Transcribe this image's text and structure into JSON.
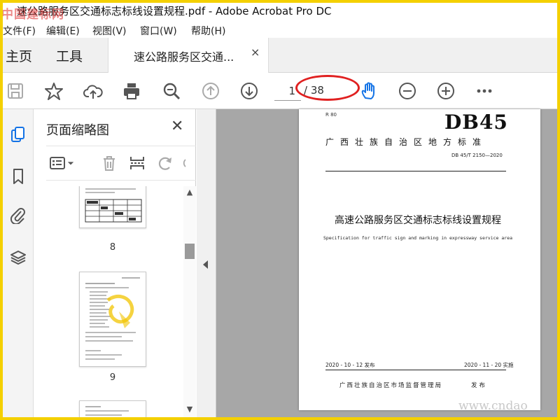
{
  "window": {
    "title": "速公路服务区交通标志标线设置规程.pdf - Adobe Acrobat Pro DC",
    "watermark_top": "中国建标网",
    "watermark_bottom": "www.cndao"
  },
  "menu": [
    "文件(F)",
    "编辑(E)",
    "视图(V)",
    "窗口(W)",
    "帮助(H)"
  ],
  "tabs": {
    "home": "主页",
    "tools": "工具",
    "document": "速公路服务区交通...",
    "close": "×"
  },
  "toolbar": {
    "icons": [
      "save-icon",
      "bookmark-star-icon",
      "upload-cloud-icon",
      "print-icon",
      "zoom-search-icon",
      "page-up-icon",
      "page-down-icon",
      "hand-tool-icon",
      "zoom-out-icon",
      "zoom-in-icon",
      "more-icon"
    ],
    "current_page": "1",
    "total_pages": "/ 38"
  },
  "thumbnails": {
    "title": "页面缩略图",
    "close": "✕",
    "pages": [
      {
        "label": "8"
      },
      {
        "label": "9"
      }
    ]
  },
  "document": {
    "std_category": "R 80",
    "db_code": "DB45",
    "issuing_region": "广西壮族自治区地方标准",
    "standard_number": "DB 45/T 2150—2020",
    "title_cn": "高速公路服务区交通标志标线设置规程",
    "title_en": "Specification for traffic sign and marking in expressway service area",
    "release_date": "2020 - 10 - 12 发布",
    "implement_date": "2020 - 11 - 20 实施",
    "issuer": "广西壮族自治区市场监督管理局",
    "publish": "发布"
  },
  "colors": {
    "border": "#f4d000",
    "hand_tool_blue": "#1473e6",
    "annotation_red": "#e02020",
    "doc_background": "#a7a7a7"
  }
}
